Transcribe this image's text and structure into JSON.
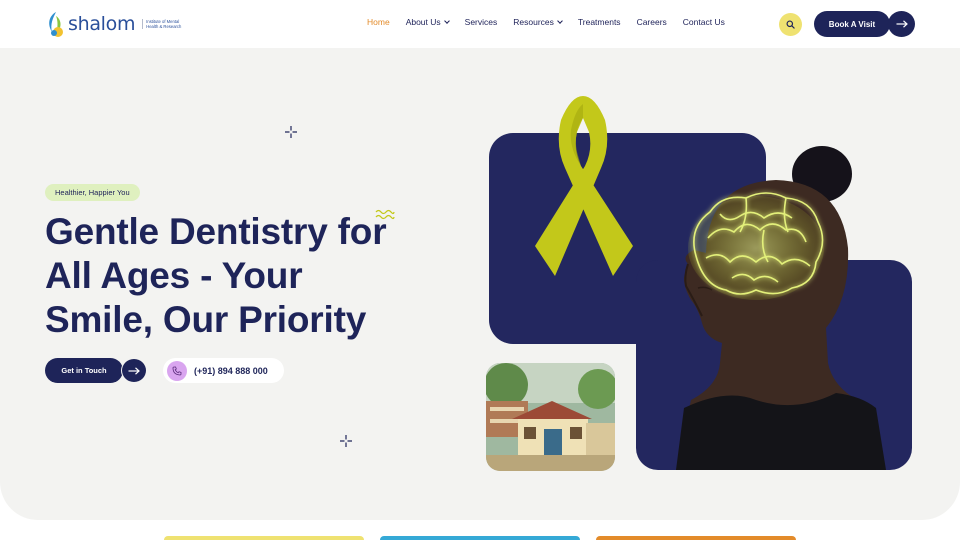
{
  "brand": {
    "name": "shalom",
    "tagline": "Institute of Mental Health & Research"
  },
  "nav": {
    "items": [
      {
        "label": "Home",
        "active": true,
        "has_dropdown": false
      },
      {
        "label": "About Us",
        "active": false,
        "has_dropdown": true
      },
      {
        "label": "Services",
        "active": false,
        "has_dropdown": false
      },
      {
        "label": "Resources",
        "active": false,
        "has_dropdown": true
      },
      {
        "label": "Treatments",
        "active": false,
        "has_dropdown": false
      },
      {
        "label": "Careers",
        "active": false,
        "has_dropdown": false
      },
      {
        "label": "Contact Us",
        "active": false,
        "has_dropdown": false
      }
    ],
    "book_label": "Book A Visit"
  },
  "hero": {
    "badge": "Healthier, Happier You",
    "headline": "Gentle Dentistry for All Ages - Your Smile, Our Priority",
    "cta_label": "Get in Touch",
    "phone": "(+91) 894 888 000"
  },
  "colors": {
    "navy": "#1e2459",
    "accent_orange": "#e38b2a",
    "accent_yellow": "#efe271",
    "badge_green": "#dff0bf",
    "hero_bg": "#f3f3f1",
    "ribbon": "#c3c81a",
    "phone_icon_bg": "#d9a5ef"
  },
  "icons": [
    "search-icon",
    "arrow-right-icon",
    "phone-icon",
    "sparkle-icon",
    "wave-icon",
    "chevron-down-icon",
    "awareness-ribbon",
    "glowing-brain"
  ]
}
